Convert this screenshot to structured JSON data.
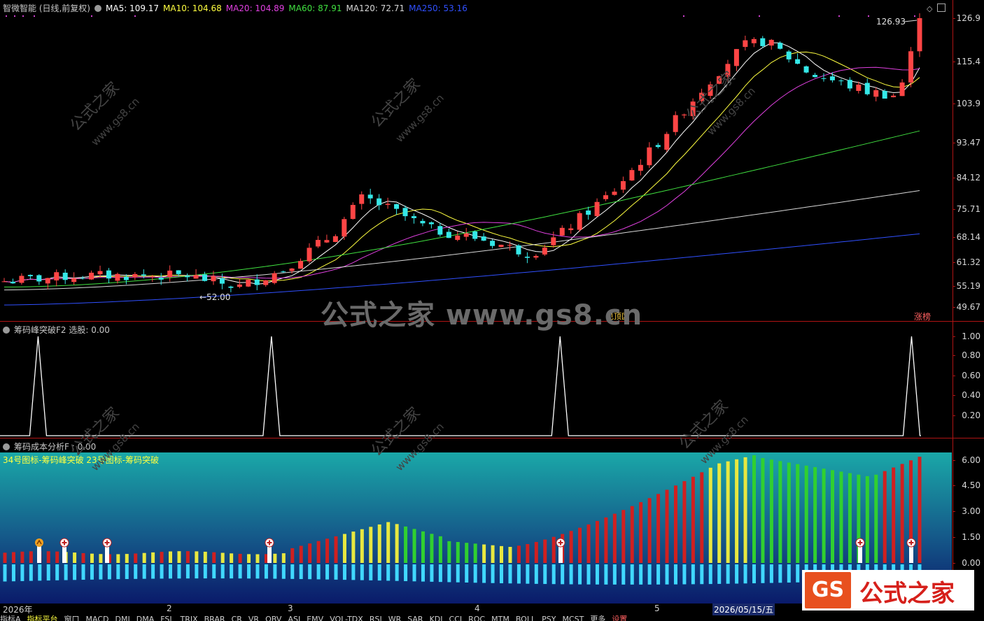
{
  "main": {
    "title": "智微智能 (日线,前复权)",
    "mas": [
      {
        "label": "MA5: 109.17",
        "color": "#ffffff"
      },
      {
        "label": "MA10: 104.68",
        "color": "#ffff40"
      },
      {
        "label": "MA20: 104.89",
        "color": "#e040e0"
      },
      {
        "label": "MA60: 87.91",
        "color": "#40e040"
      },
      {
        "label": "MA120: 72.71",
        "color": "#d8d8d8"
      },
      {
        "label": "MA250: 53.16",
        "color": "#3050ff"
      }
    ],
    "high_label": "126.93",
    "low_label": "←52.00",
    "tag_right": "涨榜",
    "tag_mid": "见顶区",
    "y_ticks": [
      "126.9",
      "115.4",
      "103.9",
      "93.47",
      "84.12",
      "75.71",
      "68.14",
      "61.32",
      "55.19",
      "49.67"
    ]
  },
  "chart_data": [
    {
      "type": "line",
      "panel": "main",
      "title": "智微智能 (日线,前复权)",
      "ylim": [
        49.67,
        126.93
      ],
      "scale": "log",
      "series": [
        {
          "name": "MA5",
          "values": [
            109.17
          ]
        },
        {
          "name": "MA10",
          "values": [
            104.68
          ]
        },
        {
          "name": "MA20",
          "values": [
            104.89
          ]
        },
        {
          "name": "MA60",
          "values": [
            87.91
          ]
        },
        {
          "name": "MA120",
          "values": [
            72.71
          ]
        },
        {
          "name": "MA250",
          "values": [
            53.16
          ]
        }
      ],
      "annotations": [
        "126.93",
        "←52.00"
      ]
    },
    {
      "type": "line",
      "panel": "indicator-1",
      "title": "筹码峰突破F2 选股: 0.00",
      "ylim": [
        0,
        1.0
      ],
      "y_ticks": [
        "1.00",
        "0.80",
        "0.60",
        "0.40",
        "0.20"
      ],
      "signal_positions": [
        0.04,
        0.285,
        0.588,
        0.957
      ]
    },
    {
      "type": "bar",
      "panel": "indicator-2",
      "title": "筹码成本分析F : 0.00",
      "ylim": [
        -1.2,
        6.4
      ],
      "y_ticks": [
        "6.00",
        "4.50",
        "3.00",
        "1.50",
        "0.00"
      ],
      "legend": "34号图标-筹码峰突破 23号图标-筹码突破"
    }
  ],
  "ind1": {
    "title": "筹码峰突破F2 选股: 0.00",
    "y_ticks": [
      "1.00",
      "0.80",
      "0.60",
      "0.40",
      "0.20"
    ]
  },
  "ind2": {
    "title": "筹码成本分析F : 0.00",
    "legend": "34号图标-筹码峰突破 23号图标-筹码突破",
    "y_ticks": [
      "6.00",
      "4.50",
      "3.00",
      "1.50",
      "0.00"
    ]
  },
  "timebar": {
    "labels": [
      "2026年",
      "2",
      "3",
      "4",
      "5",
      "2026/05/15/五"
    ]
  },
  "tabs": [
    "指标A",
    "指标平台",
    "窗口",
    "MACD",
    "DMI",
    "DMA",
    "FSL",
    "TRIX",
    "BRAR",
    "CR",
    "VR",
    "OBV",
    "ASI",
    "EMV",
    "VOL-TDX",
    "RSI",
    "WR",
    "SAR",
    "KDJ",
    "CCI",
    "ROC",
    "MTM",
    "BOLL",
    "PSY",
    "MCST",
    "更多",
    "设置"
  ],
  "watermark": {
    "text": "公式之家 www.gs8.cn",
    "small": "公式之家",
    "url": "www.gs8.cn"
  },
  "logo": {
    "mark": "GS",
    "text": "公式之家"
  }
}
